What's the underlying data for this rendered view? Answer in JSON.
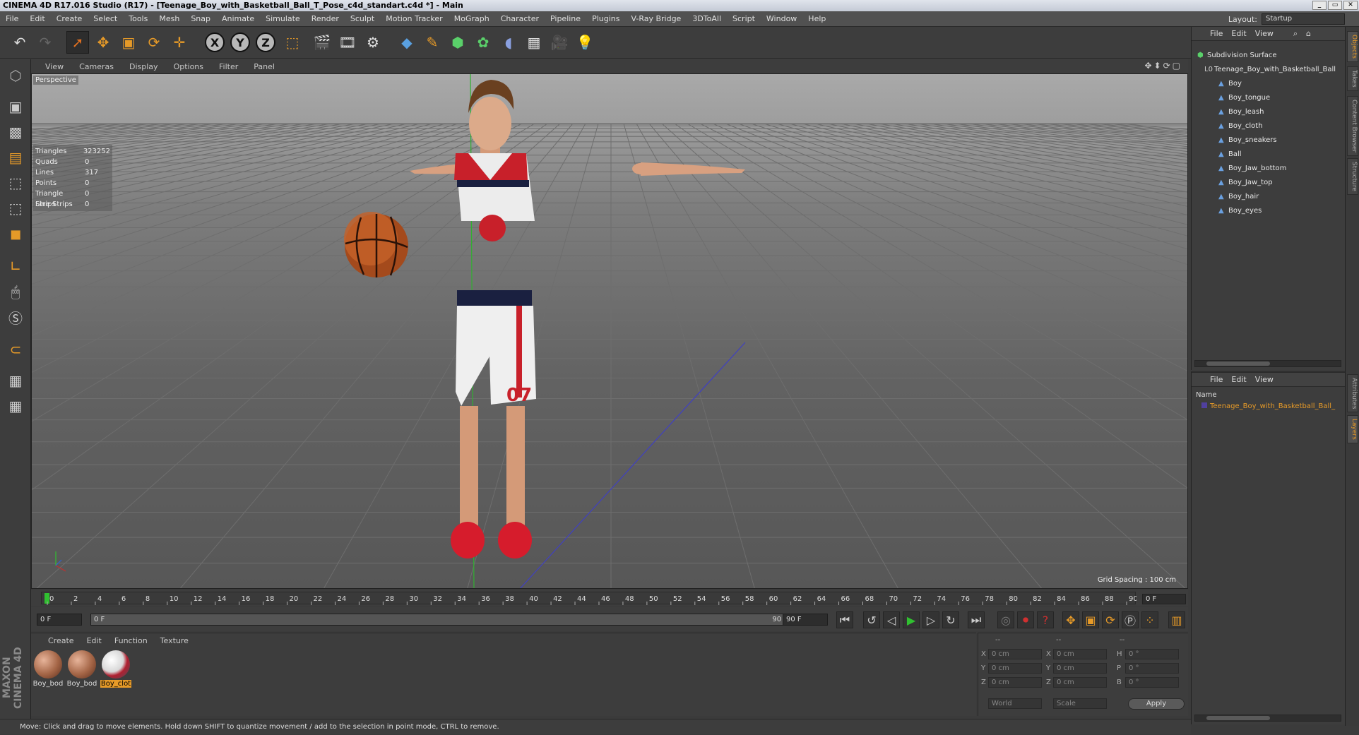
{
  "window": {
    "title": "CINEMA 4D R17.016 Studio (R17) - [Teenage_Boy_with_Basketball_Ball_T_Pose_c4d_standart.c4d *] - Main"
  },
  "menubar": {
    "items": [
      "File",
      "Edit",
      "Create",
      "Select",
      "Tools",
      "Mesh",
      "Snap",
      "Animate",
      "Simulate",
      "Render",
      "Sculpt",
      "Motion Tracker",
      "MoGraph",
      "Character",
      "Pipeline",
      "Plugins",
      "V-Ray Bridge",
      "3DToAll",
      "Script",
      "Window",
      "Help"
    ],
    "layout_label": "Layout:",
    "layout_value": "Startup"
  },
  "viewport": {
    "menu": [
      "View",
      "Cameras",
      "Display",
      "Options",
      "Filter",
      "Panel"
    ],
    "label": "Perspective",
    "grid_spacing": "Grid Spacing : 100 cm",
    "stats": [
      {
        "k": "Triangles",
        "v": "323252"
      },
      {
        "k": "Quads",
        "v": "0"
      },
      {
        "k": "Lines",
        "v": "317"
      },
      {
        "k": "Points",
        "v": "0"
      },
      {
        "k": "Triangle Strips",
        "v": "0"
      },
      {
        "k": "Line Strips",
        "v": "0"
      }
    ],
    "jersey_text": "07"
  },
  "timeline": {
    "ticks": [
      "0",
      "2",
      "4",
      "6",
      "8",
      "10",
      "12",
      "14",
      "16",
      "18",
      "20",
      "22",
      "24",
      "26",
      "28",
      "30",
      "32",
      "34",
      "36",
      "38",
      "40",
      "42",
      "44",
      "46",
      "48",
      "50",
      "52",
      "54",
      "56",
      "58",
      "60",
      "62",
      "64",
      "66",
      "68",
      "70",
      "72",
      "74",
      "76",
      "78",
      "80",
      "82",
      "84",
      "86",
      "88",
      "90"
    ],
    "current_frame": "0 F"
  },
  "transport": {
    "start_field": "0 F",
    "range_start": "0 F",
    "range_end": "90 F",
    "end_field": "90 F"
  },
  "materials": {
    "menu": [
      "Create",
      "Edit",
      "Function",
      "Texture"
    ],
    "items": [
      {
        "label": "Boy_bod"
      },
      {
        "label": "Boy_bod"
      },
      {
        "label": "Boy_clot"
      }
    ]
  },
  "coords": {
    "header_dashes": [
      "--",
      "--",
      "--"
    ],
    "rows": [
      {
        "a": "X",
        "av": "0 cm",
        "b": "X",
        "bv": "0 cm",
        "c": "H",
        "cv": "0 °"
      },
      {
        "a": "Y",
        "av": "0 cm",
        "b": "Y",
        "bv": "0 cm",
        "c": "P",
        "cv": "0 °"
      },
      {
        "a": "Z",
        "av": "0 cm",
        "b": "Z",
        "bv": "0 cm",
        "c": "B",
        "cv": "0 °"
      }
    ],
    "world": "World",
    "scale": "Scale",
    "apply": "Apply"
  },
  "objects": {
    "menu": [
      "File",
      "Edit",
      "View"
    ],
    "root": "Subdivision Surface",
    "group": "Teenage_Boy_with_Basketball_Ball",
    "children": [
      "Boy",
      "Boy_tongue",
      "Boy_leash",
      "Boy_cloth",
      "Boy_sneakers",
      "Ball",
      "Boy_Jaw_bottom",
      "Boy_Jaw_top",
      "Boy_hair",
      "Boy_eyes"
    ]
  },
  "layers": {
    "menu": [
      "File",
      "Edit",
      "View"
    ],
    "name_header": "Name",
    "item": "Teenage_Boy_with_Basketball_Ball_"
  },
  "right_tabs": {
    "top": [
      "Objects",
      "Takes",
      "Content Browser",
      "Structure"
    ],
    "bottom": [
      "Attributes",
      "Layers"
    ]
  },
  "status": "Move: Click and drag to move elements. Hold down SHIFT to quantize movement / add to the selection in point mode, CTRL to remove.",
  "logo": "MAXON CINEMA 4D"
}
